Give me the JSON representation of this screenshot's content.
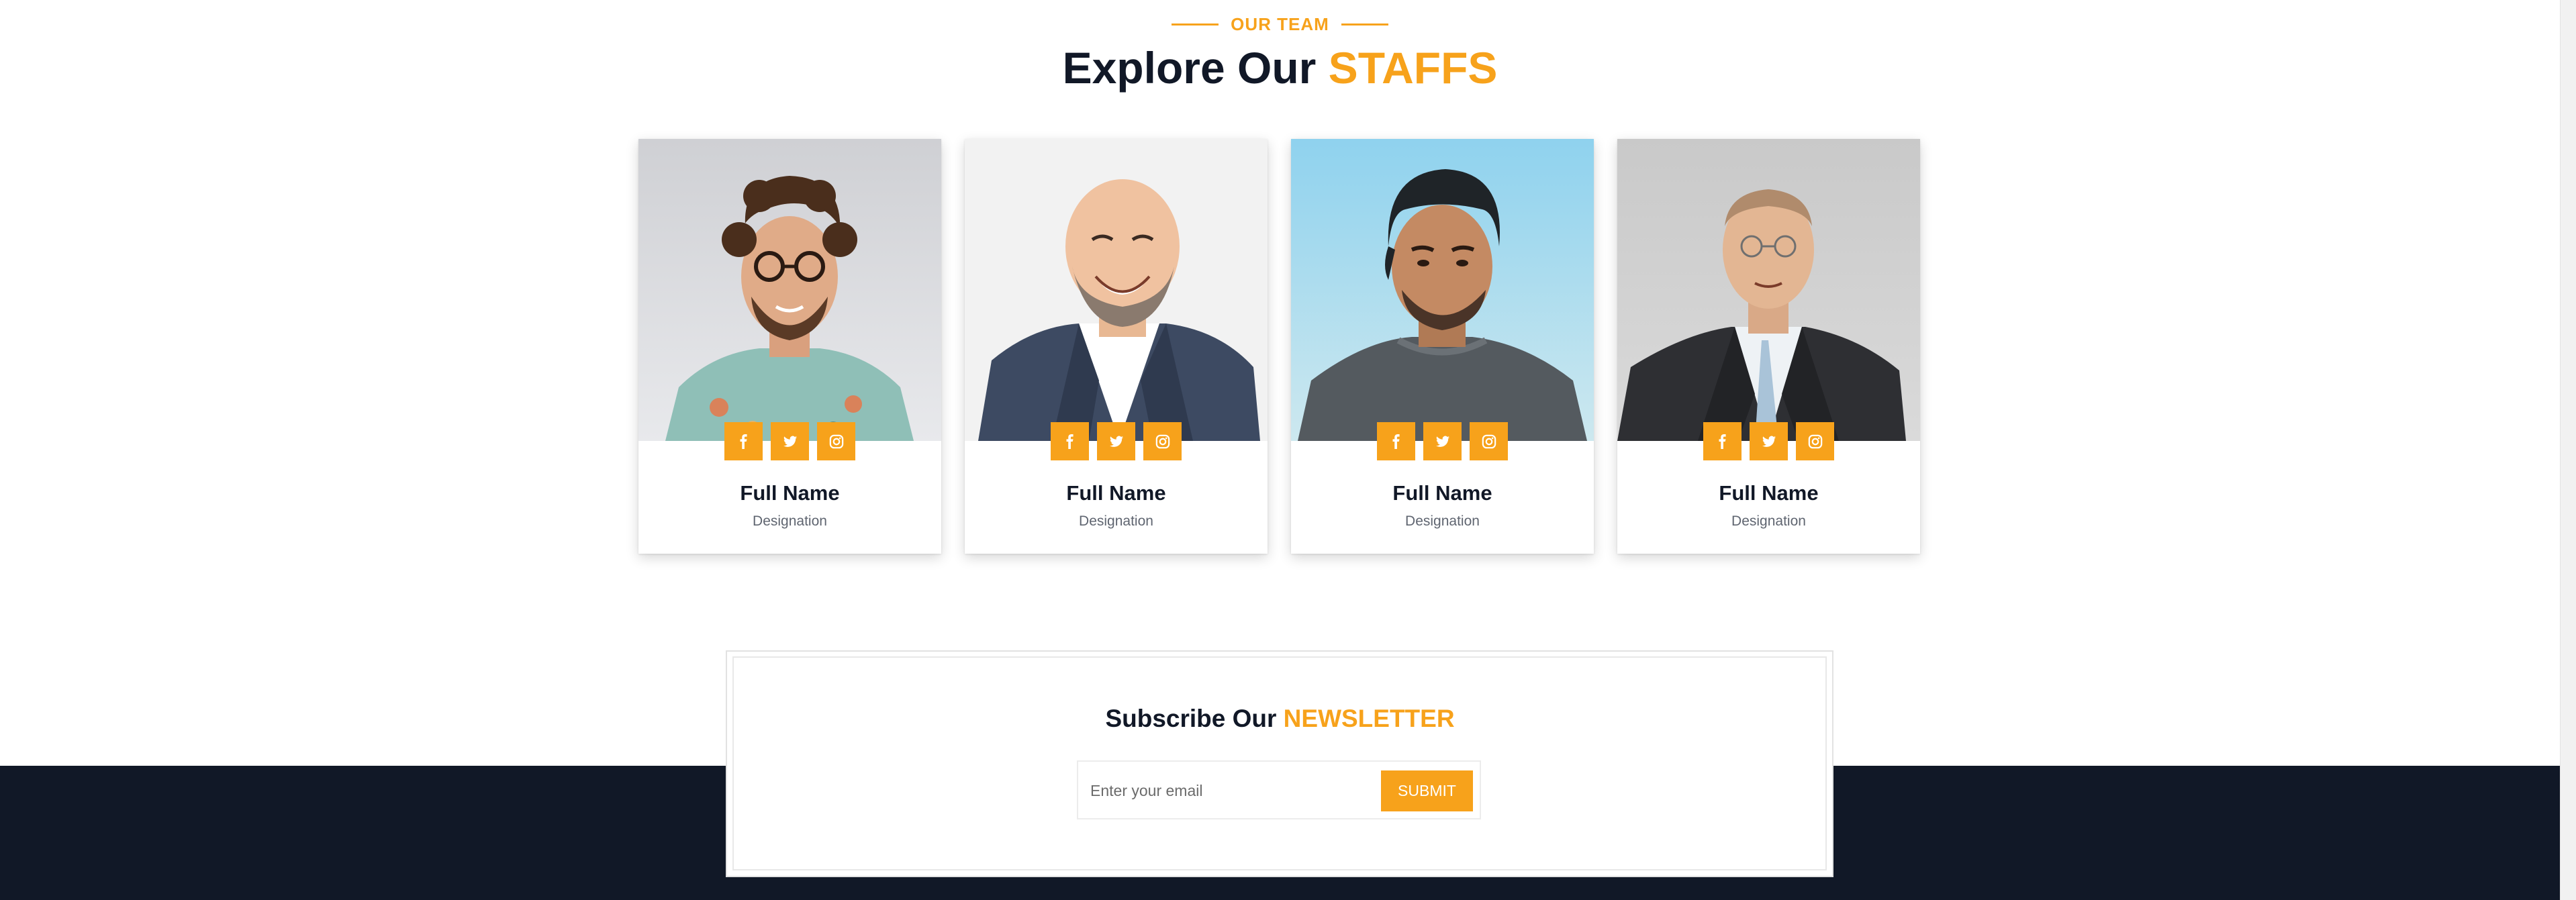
{
  "team_section": {
    "eyebrow": "OUR TEAM",
    "title_main": "Explore Our",
    "title_accent": "STAFFS"
  },
  "staff": [
    {
      "name": "Full Name",
      "designation": "Designation"
    },
    {
      "name": "Full Name",
      "designation": "Designation"
    },
    {
      "name": "Full Name",
      "designation": "Designation"
    },
    {
      "name": "Full Name",
      "designation": "Designation"
    }
  ],
  "social_icons": [
    "facebook-icon",
    "twitter-icon",
    "instagram-icon"
  ],
  "newsletter": {
    "title_main": "Subscribe Our",
    "title_accent": "NEWSLETTER",
    "email_placeholder": "Enter your email",
    "submit_label": "SUBMIT"
  },
  "colors": {
    "accent": "#f7a21b",
    "dark": "#111827",
    "text_muted": "#5f6570"
  }
}
